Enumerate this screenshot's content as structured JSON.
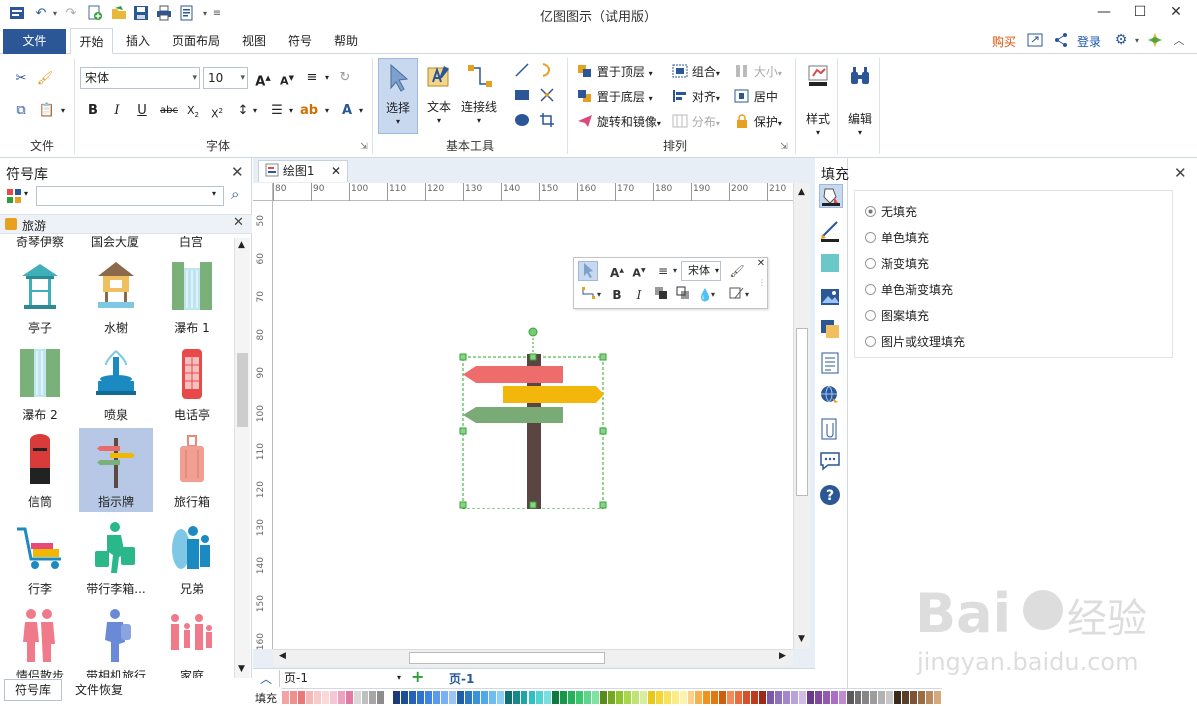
{
  "window": {
    "title": "亿图图示（试用版）"
  },
  "menu": {
    "file": "文件",
    "tabs": [
      "开始",
      "插入",
      "页面布局",
      "视图",
      "符号",
      "帮助"
    ],
    "buy": "购买",
    "login": "登录"
  },
  "ribbon": {
    "groups": {
      "file": "文件",
      "font": "字体",
      "basic_tools": "基本工具",
      "arrange": "排列"
    },
    "font_name": "宋体",
    "font_size": "10",
    "select": "选择",
    "text": "文本",
    "connector": "连接线",
    "bring_to_front": "置于顶层",
    "send_to_back": "置于底层",
    "rotate_mirror": "旋转和镜像",
    "group": "组合",
    "align": "对齐",
    "distribute": "分布",
    "size": "大小",
    "center": "居中",
    "protect": "保护",
    "style": "样式",
    "edit": "编辑"
  },
  "library": {
    "title": "符号库",
    "search_placeholder": "",
    "category": "旅游",
    "partial_top": [
      "奇琴伊察",
      "国会大厦",
      "白宫"
    ],
    "symbols": [
      "亭子",
      "水榭",
      "瀑布 1",
      "瀑布 2",
      "喷泉",
      "电话亭",
      "信筒",
      "指示牌",
      "旅行箱",
      "行李",
      "带行李箱...",
      "兄弟",
      "情侣散步",
      "带相机旅行",
      "家庭"
    ],
    "selected": "指示牌",
    "bottom_tabs": [
      "符号库",
      "文件恢复"
    ]
  },
  "canvas": {
    "doc_tab": "绘图1",
    "hruler": [
      "80",
      "90",
      "100",
      "110",
      "120",
      "130",
      "140",
      "150",
      "160",
      "170",
      "180",
      "190",
      "200",
      "210"
    ],
    "vruler": [
      "50",
      "60",
      "70",
      "80",
      "90",
      "100",
      "110",
      "120",
      "130",
      "140",
      "150",
      "160"
    ],
    "page_selector": "页-1",
    "page_tab": "页-1"
  },
  "floating_toolbar": {
    "font": "宋体"
  },
  "fill_panel": {
    "title": "填充",
    "options": [
      "无填充",
      "单色填充",
      "渐变填充",
      "单色渐变填充",
      "图案填充",
      "图片或纹理填充"
    ],
    "selected": "无填充"
  },
  "palette": {
    "label": "填充",
    "colors": [
      "#f2a3a3",
      "#ef8f8f",
      "#e97979",
      "#f5b7b7",
      "#f8caca",
      "#fbd9d9",
      "#f5c6d6",
      "#ef9fbf",
      "#e27aa6",
      "#d9d9d9",
      "#bfbfbf",
      "#a6a6a6",
      "#8c8c8c",
      "#ffffff",
      "#1a3a7a",
      "#1f4e99",
      "#2660b8",
      "#2e72d2",
      "#3c84e6",
      "#5a9af0",
      "#7cb0f4",
      "#9cc4f8",
      "#1d5ea8",
      "#2b78c4",
      "#3a92da",
      "#50a8ea",
      "#6dbcf2",
      "#8ccff6",
      "#0f6e6e",
      "#168a8a",
      "#1fa5a5",
      "#2ec1c1",
      "#51d3d3",
      "#79e0e0",
      "#0e7a3c",
      "#18964a",
      "#23b25a",
      "#38c66e",
      "#5cd68a",
      "#82e2a6",
      "#5a8a1a",
      "#74a822",
      "#8ec42c",
      "#a8d84a",
      "#c0e474",
      "#d8ee9e",
      "#e8c81a",
      "#f2d634",
      "#f8e25a",
      "#fcec84",
      "#fdf3ad",
      "#fcd08a",
      "#f6b04e",
      "#f09220",
      "#e27812",
      "#cc5e0c",
      "#f28a5a",
      "#e86c3c",
      "#d6502a",
      "#bc3a1e",
      "#9c2a16",
      "#7a5aa8",
      "#8e70bc",
      "#a488cc",
      "#baa2da",
      "#d0bce6",
      "#6a3a8a",
      "#80489e",
      "#9658b2",
      "#aa6ec4",
      "#c08ad4",
      "#5a5a5a",
      "#707070",
      "#868686",
      "#9c9c9c",
      "#b2b2b2",
      "#c8c8c8",
      "#3a2a1a",
      "#5a3e26",
      "#7a5434",
      "#9a6c44",
      "#ba8a5e",
      "#d6a87e"
    ]
  }
}
